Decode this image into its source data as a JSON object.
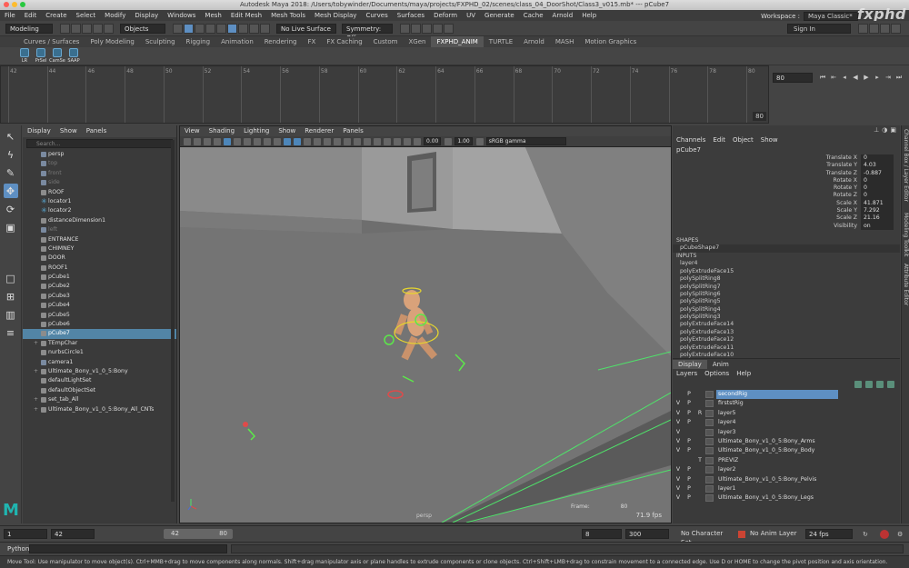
{
  "window": {
    "title": "Autodesk Maya 2018: /Users/tobywinder/Documents/maya/projects/FXPHD_02/scenes/class_04_DoorShot/Class3_v015.mb*  ---  pCube7"
  },
  "watermark": "fxphd",
  "menubar": {
    "items": [
      "File",
      "Edit",
      "Create",
      "Select",
      "Modify",
      "Display",
      "Windows",
      "Mesh",
      "Edit Mesh",
      "Mesh Tools",
      "Mesh Display",
      "Curves",
      "Surfaces",
      "Deform",
      "UV",
      "Generate",
      "Cache",
      "Arnold",
      "Help"
    ],
    "workspace_label": "Workspace :",
    "workspace_value": "Maya Classic*"
  },
  "statusline": {
    "mode": "Modeling",
    "objects": "Objects",
    "live_surface": "No Live Surface",
    "symmetry": "Symmetry: Off",
    "signin": "Sign In"
  },
  "shelf": {
    "tabs": [
      "Curves / Surfaces",
      "Poly Modeling",
      "Sculpting",
      "Rigging",
      "Animation",
      "Rendering",
      "FX",
      "FX Caching",
      "Custom",
      "XGen",
      "FXPHD_ANIM",
      "TURTLE",
      "Arnold",
      "MASH",
      "Motion Graphics"
    ],
    "active_tab": "FXPHD_ANIM",
    "icons": [
      "LR",
      "PrSel",
      "CamSe",
      "SAAP"
    ]
  },
  "timeslider": {
    "tick_labels": [
      "42",
      "44",
      "46",
      "48",
      "50",
      "52",
      "54",
      "56",
      "58",
      "60",
      "62",
      "64",
      "66",
      "68",
      "70",
      "72",
      "74",
      "76",
      "78",
      "80"
    ],
    "end_label": "80",
    "current_frame": "80"
  },
  "outliner": {
    "menu": [
      "Display",
      "Show",
      "Panels"
    ],
    "search_placeholder": "Search...",
    "items": [
      {
        "label": "persp",
        "icon": "camera",
        "dim": false
      },
      {
        "label": "top",
        "icon": "camera",
        "dim": true
      },
      {
        "label": "front",
        "icon": "camera",
        "dim": true
      },
      {
        "label": "side",
        "icon": "camera",
        "dim": true
      },
      {
        "label": "ROOF",
        "icon": "mesh",
        "dim": false
      },
      {
        "label": "locator1",
        "icon": "locator",
        "dim": false
      },
      {
        "label": "locator2",
        "icon": "locator",
        "dim": false
      },
      {
        "label": "distanceDimension1",
        "icon": "mesh",
        "dim": false
      },
      {
        "label": "left",
        "icon": "camera",
        "dim": true
      },
      {
        "label": "ENTRANCE",
        "icon": "mesh",
        "dim": false
      },
      {
        "label": "CHIMNEY",
        "icon": "mesh",
        "dim": false
      },
      {
        "label": "DOOR",
        "icon": "mesh",
        "dim": false
      },
      {
        "label": "ROOF1",
        "icon": "mesh",
        "dim": false
      },
      {
        "label": "pCube1",
        "icon": "mesh",
        "dim": false
      },
      {
        "label": "pCube2",
        "icon": "mesh",
        "dim": false
      },
      {
        "label": "pCube3",
        "icon": "mesh",
        "dim": false
      },
      {
        "label": "pCube4",
        "icon": "mesh",
        "dim": false
      },
      {
        "label": "pCube5",
        "icon": "mesh",
        "dim": false
      },
      {
        "label": "pCube6",
        "icon": "mesh",
        "dim": false
      },
      {
        "label": "pCube7",
        "icon": "mesh",
        "dim": false,
        "selected": true
      },
      {
        "label": "TEmpChar",
        "icon": "mesh",
        "dim": false,
        "expand": true
      },
      {
        "label": "nurbsCircle1",
        "icon": "curve",
        "dim": false
      },
      {
        "label": "camera1",
        "icon": "camera",
        "dim": false
      },
      {
        "label": "Ultimate_Bony_v1_0_5:Bony",
        "icon": "mesh",
        "dim": false,
        "expand": true
      },
      {
        "label": "defaultLightSet",
        "icon": "set",
        "dim": false
      },
      {
        "label": "defaultObjectSet",
        "icon": "set",
        "dim": false
      },
      {
        "label": "set_tab_All",
        "icon": "set",
        "dim": false,
        "expand": true
      },
      {
        "label": "Ultimate_Bony_v1_0_5:Bony_All_CNTs",
        "icon": "set",
        "dim": false,
        "expand": true
      }
    ]
  },
  "viewport": {
    "menu": [
      "View",
      "Shading",
      "Lighting",
      "Show",
      "Renderer",
      "Panels"
    ],
    "exposure": "0.00",
    "gamma": "1.00",
    "colorspace": "sRGB gamma",
    "hud_frame_label": "Frame:",
    "hud_frame_value": "80",
    "fps": "71.9 fps",
    "camera": "persp"
  },
  "channelbox": {
    "menu": [
      "Channels",
      "Edit",
      "Object",
      "Show"
    ],
    "node": "pCube7",
    "attributes": [
      {
        "name": "Translate X",
        "value": "0"
      },
      {
        "name": "Translate Y",
        "value": "4.03"
      },
      {
        "name": "Translate Z",
        "value": "-0.887"
      },
      {
        "name": "Rotate X",
        "value": "0"
      },
      {
        "name": "Rotate Y",
        "value": "0"
      },
      {
        "name": "Rotate Z",
        "value": "0"
      },
      {
        "name": "Scale X",
        "value": "41.871"
      },
      {
        "name": "Scale Y",
        "value": "7.292"
      },
      {
        "name": "Scale Z",
        "value": "21.16"
      },
      {
        "name": "Visibility",
        "value": "on"
      }
    ],
    "shapes_label": "SHAPES",
    "shape": "pCubeShape7",
    "inputs_label": "INPUTS",
    "inputs": [
      "layer4",
      "polyExtrudeFace15",
      "polySplitRing8",
      "polySplitRing7",
      "polySplitRing6",
      "polySplitRing5",
      "polySplitRing4",
      "polySplitRing3",
      "polyExtrudeFace14",
      "polyExtrudeFace13",
      "polyExtrudeFace12",
      "polyExtrudeFace11",
      "polyExtrudeFace10"
    ]
  },
  "sidetabs": [
    "Channel Box / Layer Editor",
    "Modeling Toolkit",
    "Attribute Editor"
  ],
  "layereditor": {
    "tabs": [
      "Display",
      "Anim"
    ],
    "active_tab": "Display",
    "menu": [
      "Layers",
      "Options",
      "Help"
    ],
    "layers": [
      {
        "v": "",
        "p": "P",
        "r": "",
        "name": "secondRig",
        "selected": true
      },
      {
        "v": "V",
        "p": "P",
        "r": "",
        "name": "firststRig"
      },
      {
        "v": "V",
        "p": "P",
        "r": "R",
        "name": "layer5"
      },
      {
        "v": "V",
        "p": "P",
        "r": "",
        "name": "layer4"
      },
      {
        "v": "V",
        "p": "",
        "r": "",
        "name": "layer3"
      },
      {
        "v": "V",
        "p": "P",
        "r": "",
        "name": "Ultimate_Bony_v1_0_5:Bony_Arms"
      },
      {
        "v": "V",
        "p": "P",
        "r": "",
        "name": "Ultimate_Bony_v1_0_5:Bony_Body"
      },
      {
        "v": "",
        "p": "",
        "r": "T",
        "name": "PREVIZ"
      },
      {
        "v": "V",
        "p": "P",
        "r": "",
        "name": "layer2"
      },
      {
        "v": "V",
        "p": "P",
        "r": "",
        "name": "Ultimate_Bony_v1_0_5:Bony_Pelvis"
      },
      {
        "v": "V",
        "p": "P",
        "r": "",
        "name": "layer1"
      },
      {
        "v": "V",
        "p": "P",
        "r": "",
        "name": "Ultimate_Bony_v1_0_5:Bony_Legs"
      }
    ]
  },
  "rangebar": {
    "start": "1",
    "range_start": "42",
    "slider_start": "42",
    "slider_end": "80",
    "range_end": "8",
    "end": "300",
    "character_set": "No Character Set",
    "anim_layer": "No Anim Layer",
    "fps": "24 fps"
  },
  "cmdline": {
    "language": "Python"
  },
  "helpline": "Move Tool: Use manipulator to move object(s). Ctrl+MMB+drag to move components along normals. Shift+drag manipulator axis or plane handles to extrude components or clone objects. Ctrl+Shift+LMB+drag to constrain movement to a connected edge. Use D or HOME to change the pivot position and axis orientation."
}
